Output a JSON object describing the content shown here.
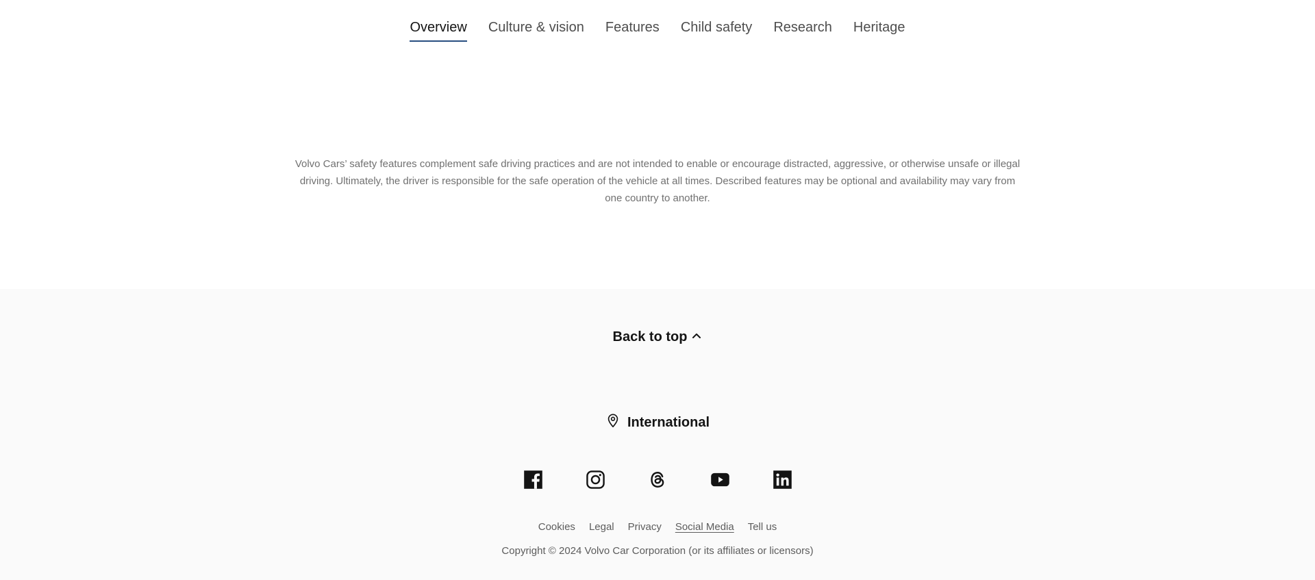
{
  "subnav": {
    "tabs": [
      {
        "label": "Overview",
        "active": true
      },
      {
        "label": "Culture & vision",
        "active": false
      },
      {
        "label": "Features",
        "active": false
      },
      {
        "label": "Child safety",
        "active": false
      },
      {
        "label": "Research",
        "active": false
      },
      {
        "label": "Heritage",
        "active": false
      }
    ],
    "accent_color": "#284e80"
  },
  "disclaimer": {
    "text": "Volvo Cars’ safety features complement safe driving practices and are not intended to enable or encourage distracted, aggressive, or otherwise unsafe or illegal driving. Ultimately, the driver is responsible for the safe operation of the vehicle at all times. Described features may be optional and availability may vary from one country to another."
  },
  "footer": {
    "back_to_top_label": "Back to top",
    "back_to_top_icon": "chevron-up-icon",
    "region_label": "International",
    "region_icon": "location-pin-icon",
    "socials": [
      {
        "name": "facebook-icon"
      },
      {
        "name": "instagram-icon"
      },
      {
        "name": "threads-icon"
      },
      {
        "name": "youtube-icon"
      },
      {
        "name": "linkedin-icon"
      }
    ],
    "links": [
      {
        "label": "Cookies",
        "underlined": false
      },
      {
        "label": "Legal",
        "underlined": false
      },
      {
        "label": "Privacy",
        "underlined": false
      },
      {
        "label": "Social Media",
        "underlined": true
      },
      {
        "label": "Tell us",
        "underlined": false
      }
    ],
    "copyright": "Copyright © 2024 Volvo Car Corporation (or its affiliates or licensors)",
    "background_color": "#fafafa"
  }
}
